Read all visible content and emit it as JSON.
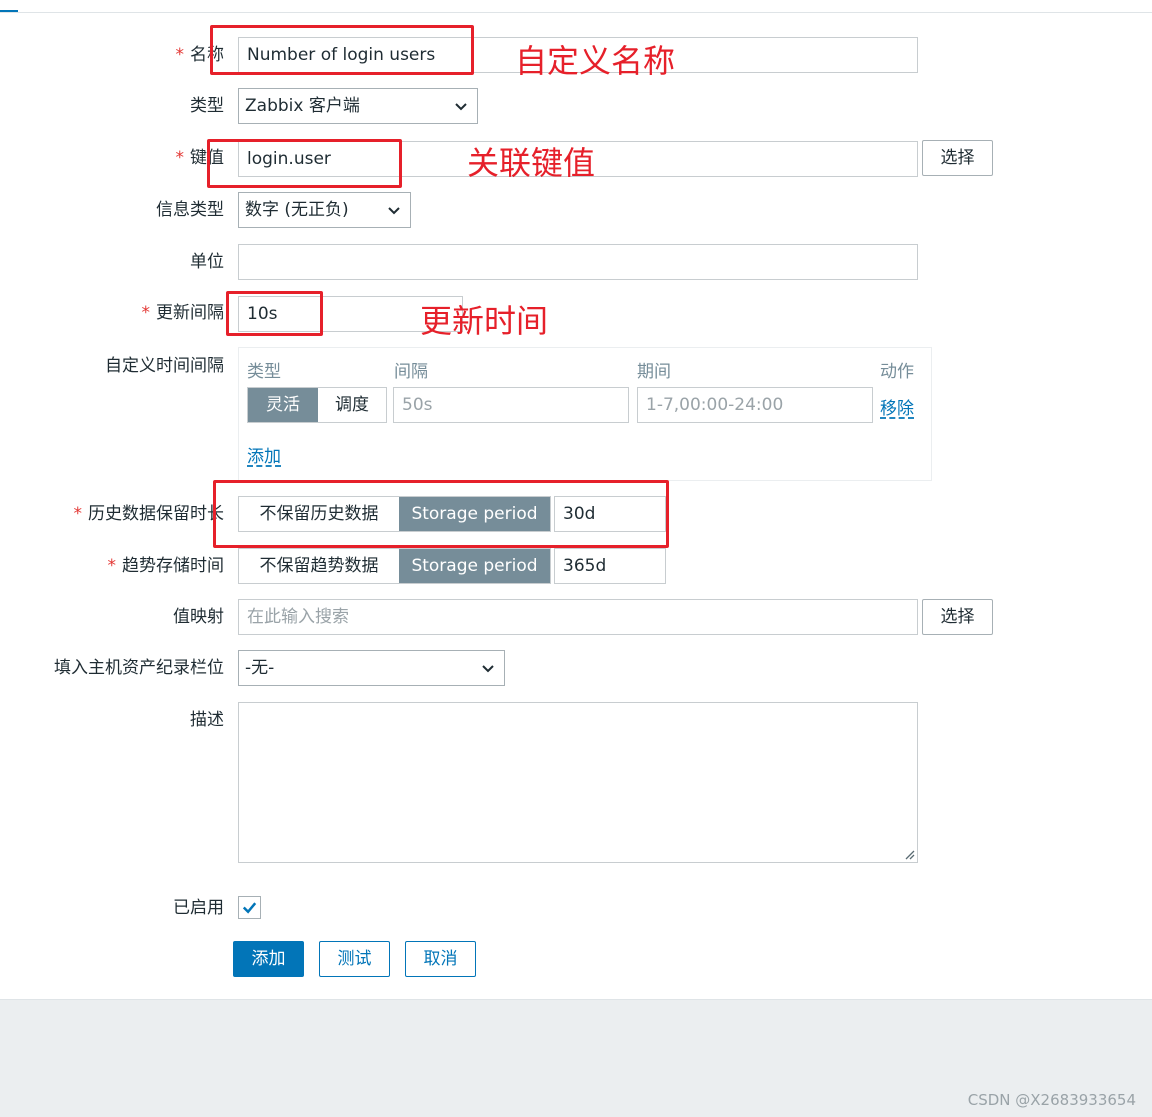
{
  "form": {
    "name": {
      "label": "名称",
      "value": "Number of login users"
    },
    "type": {
      "label": "类型",
      "value": "Zabbix 客户端"
    },
    "key": {
      "label": "键值",
      "value": "login.user",
      "select_label": "选择"
    },
    "info_type": {
      "label": "信息类型",
      "value": "数字 (无正负)"
    },
    "units": {
      "label": "单位",
      "value": ""
    },
    "update_interval": {
      "label": "更新间隔",
      "value": "10s"
    },
    "custom_intervals": {
      "label": "自定义时间间隔",
      "headers": {
        "type": "类型",
        "interval": "间隔",
        "period": "期间",
        "action": "动作"
      },
      "row": {
        "flexible": "灵活",
        "scheduling": "调度",
        "interval_placeholder": "50s",
        "period_placeholder": "1-7,00:00-24:00",
        "remove": "移除"
      },
      "add": "添加"
    },
    "history": {
      "label": "历史数据保留时长",
      "no_keep": "不保留历史数据",
      "storage": "Storage period",
      "value": "30d"
    },
    "trends": {
      "label": "趋势存储时间",
      "no_keep": "不保留趋势数据",
      "storage": "Storage period",
      "value": "365d"
    },
    "value_map": {
      "label": "值映射",
      "placeholder": "在此输入搜索",
      "select_label": "选择"
    },
    "inventory": {
      "label": "填入主机资产纪录栏位",
      "value": "-无-"
    },
    "description": {
      "label": "描述",
      "value": ""
    },
    "enabled": {
      "label": "已启用",
      "checked": true
    }
  },
  "buttons": {
    "add": "添加",
    "test": "测试",
    "cancel": "取消"
  },
  "annotations": {
    "name": "自定义名称",
    "key": "关联键值",
    "interval": "更新时间"
  },
  "watermark": "CSDN @X2683933654",
  "colors": {
    "accent": "#0275b8",
    "required": "#e33734",
    "annotation": "#e6202a",
    "segment_active": "#768d99"
  }
}
